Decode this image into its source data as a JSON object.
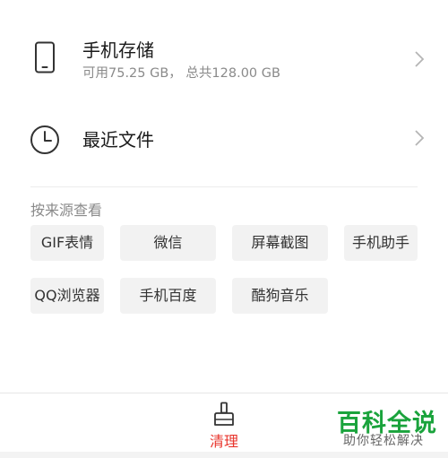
{
  "storage": {
    "title": "手机存储",
    "subtitle": "可用75.25 GB， 总共128.00 GB",
    "icon": "phone-icon"
  },
  "recent": {
    "title": "最近文件",
    "icon": "clock-icon"
  },
  "sources": {
    "label": "按来源查看",
    "chips": [
      "GIF表情",
      "微信",
      "屏幕截图",
      "手机助手",
      "QQ浏览器",
      "手机百度",
      "酷狗音乐"
    ]
  },
  "bottom_bar": {
    "clean_label": "清理",
    "clean_icon": "broom-icon",
    "accent_color": "#e8342c"
  },
  "watermark": {
    "brand": "百科全说",
    "slogan": "助你轻松解决",
    "brand_color": "#1aa33c"
  }
}
